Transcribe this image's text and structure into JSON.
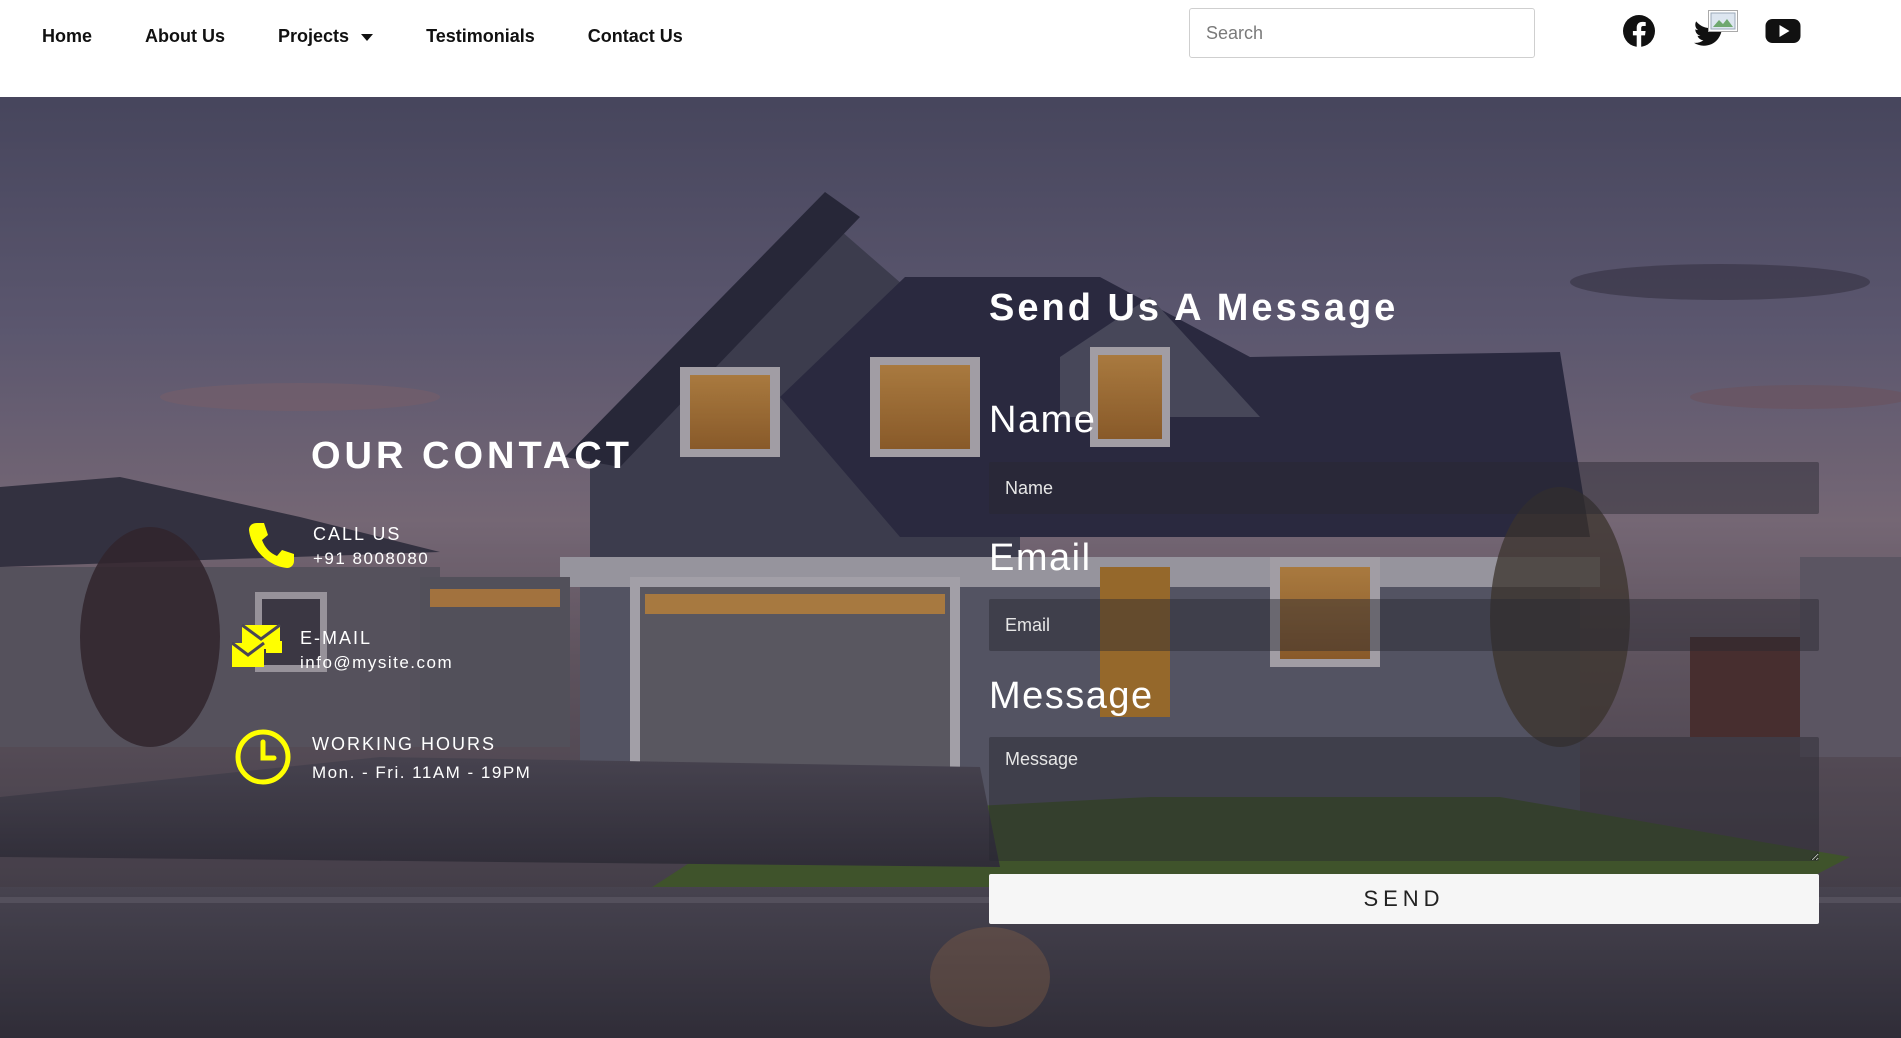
{
  "nav": {
    "items": [
      {
        "label": "Home"
      },
      {
        "label": "About Us"
      },
      {
        "label": "Projects",
        "has_dropdown": true
      },
      {
        "label": "Testimonials"
      },
      {
        "label": "Contact Us"
      }
    ]
  },
  "search": {
    "placeholder": "Search"
  },
  "social": {
    "icons": [
      "facebook-icon",
      "twitter-icon",
      "youtube-icon"
    ]
  },
  "contact": {
    "title": "OUR CONTACT",
    "call": {
      "label": "CALL US",
      "value": "+91 8008080",
      "icon": "phone-icon"
    },
    "email": {
      "label": "E-MAIL",
      "value": "info@mysite.com",
      "icon": "mail-icon"
    },
    "hours": {
      "label": "WORKING HOURS",
      "value": "Mon. - Fri. 11AM - 19PM",
      "icon": "clock-icon"
    }
  },
  "form": {
    "title": "Send Us A Message",
    "name_label": "Name",
    "name_placeholder": "Name",
    "email_label": "Email",
    "email_placeholder": "Email",
    "message_label": "Message",
    "message_placeholder": "Message",
    "send_label": "SEND"
  },
  "colors": {
    "accent": "#ffff00",
    "text_dark": "#111111",
    "white": "#ffffff"
  }
}
